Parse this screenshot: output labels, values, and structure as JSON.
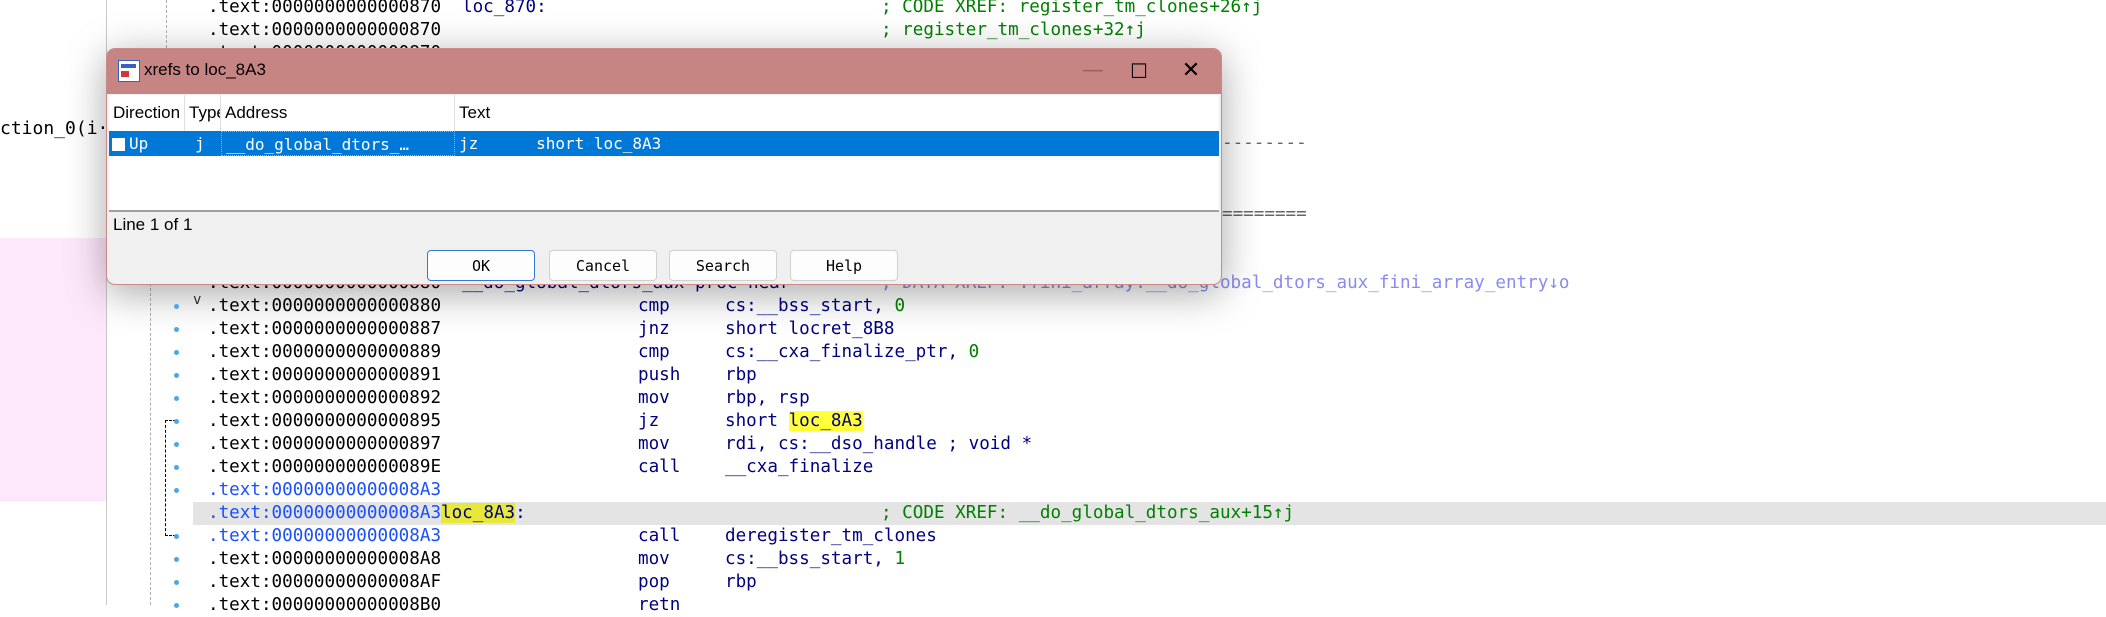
{
  "left_panel": {
    "text": "ction_0(i·"
  },
  "code_lines": [
    {
      "addr": ".text:0000000000000870",
      "label": "loc_870:",
      "mnem": "",
      "ops": "",
      "comment": "; CODE XREF: register_tm_clones+26↑j"
    },
    {
      "addr": ".text:0000000000000870",
      "label": "",
      "mnem": "",
      "ops": "",
      "comment": "; register_tm_clones+32↑j"
    },
    {
      "addr": ".text:0000000000000870",
      "label": "",
      "mnem": "",
      "ops": "",
      "comment": ""
    }
  ],
  "separators": [
    {
      "text": "--------"
    },
    {
      "text": "========"
    }
  ],
  "proc_line": {
    "addr": ".text:0000000000000880",
    "label": "__do_global_dtors_aux proc near",
    "comment": "; DATA XREF: .fini_array:__do_global_dtors_aux_fini_array_entry↓o"
  },
  "body_lines": [
    {
      "addr": ".text:0000000000000880",
      "mnem": "cmp",
      "ops": "cs:__bss_start, ",
      "num": "0"
    },
    {
      "addr": ".text:0000000000000887",
      "mnem": "jnz",
      "ops": "short locret_8B8"
    },
    {
      "addr": ".text:0000000000000889",
      "mnem": "cmp",
      "ops": "cs:__cxa_finalize_ptr, ",
      "num": "0"
    },
    {
      "addr": ".text:0000000000000891",
      "mnem": "push",
      "ops": "rbp"
    },
    {
      "addr": ".text:0000000000000892",
      "mnem": "mov",
      "ops": "rbp, rsp"
    },
    {
      "addr": ".text:0000000000000895",
      "mnem": "jz",
      "ops": "short ",
      "hl": "loc_8A3"
    },
    {
      "addr": ".text:0000000000000897",
      "mnem": "mov",
      "ops": "rdi, cs:__dso_handle ; void *"
    },
    {
      "addr": ".text:000000000000089E",
      "mnem": "call",
      "ops": "__cxa_finalize"
    },
    {
      "addr": ".text:00000000000008A3",
      "mnem": "",
      "ops": "",
      "blue": true
    }
  ],
  "highlight_line": {
    "addr": ".text:00000000000008A3",
    "label": "loc_8A3",
    "colon": ":",
    "comment": "; CODE XREF: __do_global_dtors_aux+15↑j"
  },
  "tail_lines": [
    {
      "addr": ".text:00000000000008A3",
      "mnem": "call",
      "ops": "deregister_tm_clones",
      "blue": true
    },
    {
      "addr": ".text:00000000000008A8",
      "mnem": "mov",
      "ops": "cs:__bss_start, ",
      "num": "1"
    },
    {
      "addr": ".text:00000000000008AF",
      "mnem": "pop",
      "ops": "rbp"
    },
    {
      "addr": ".text:00000000000008B0",
      "mnem": "retn",
      "ops": ""
    }
  ],
  "dialog": {
    "title": "xrefs to loc_8A3",
    "minimize": "—",
    "maximize": "☐",
    "close": "✕",
    "columns": [
      "Direction",
      "Type",
      "Address",
      "Text"
    ],
    "rows": [
      {
        "direction": "Up",
        "type": "j",
        "address": "__do_global_dtors_…",
        "text": "jz      short loc_8A3"
      }
    ],
    "status": "Line 1 of 1",
    "buttons": [
      "OK",
      "Cancel",
      "Search",
      "Help"
    ]
  },
  "colors": {
    "titlebar": "#c68583",
    "selection": "#0078d7",
    "highlight": "#ffff3a"
  }
}
